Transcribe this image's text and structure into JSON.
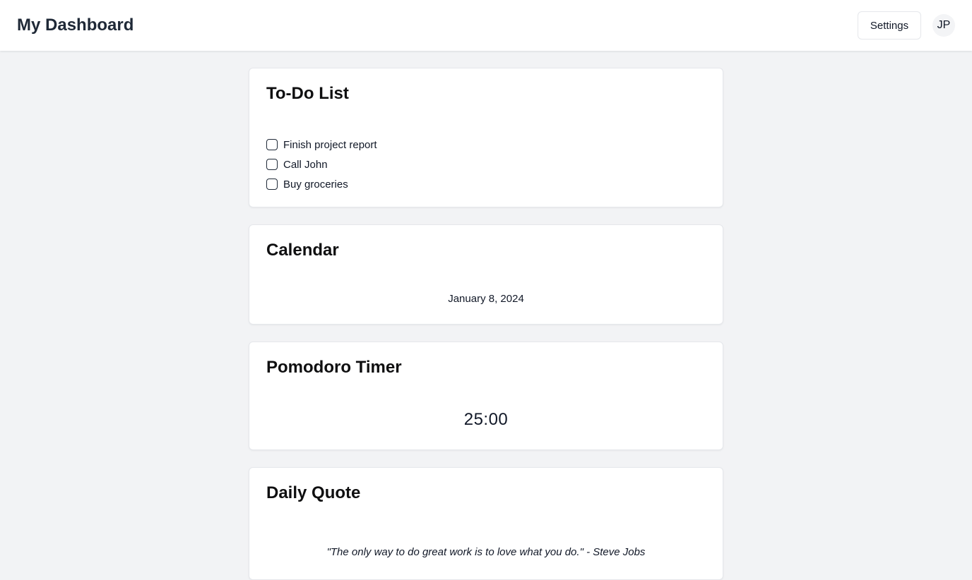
{
  "header": {
    "title": "My Dashboard",
    "settings_label": "Settings",
    "avatar_initials": "JP"
  },
  "todo": {
    "title": "To-Do List",
    "items": [
      {
        "label": "Finish project report",
        "checked": false
      },
      {
        "label": "Call John",
        "checked": false
      },
      {
        "label": "Buy groceries",
        "checked": false
      }
    ]
  },
  "calendar": {
    "title": "Calendar",
    "date": "January 8, 2024"
  },
  "pomodoro": {
    "title": "Pomodoro Timer",
    "time": "25:00"
  },
  "quote": {
    "title": "Daily Quote",
    "text": "\"The only way to do great work is to love what you do.\" - Steve Jobs"
  },
  "colors": {
    "background": "#f2f3f5",
    "card": "#ffffff",
    "text": "#111827"
  }
}
